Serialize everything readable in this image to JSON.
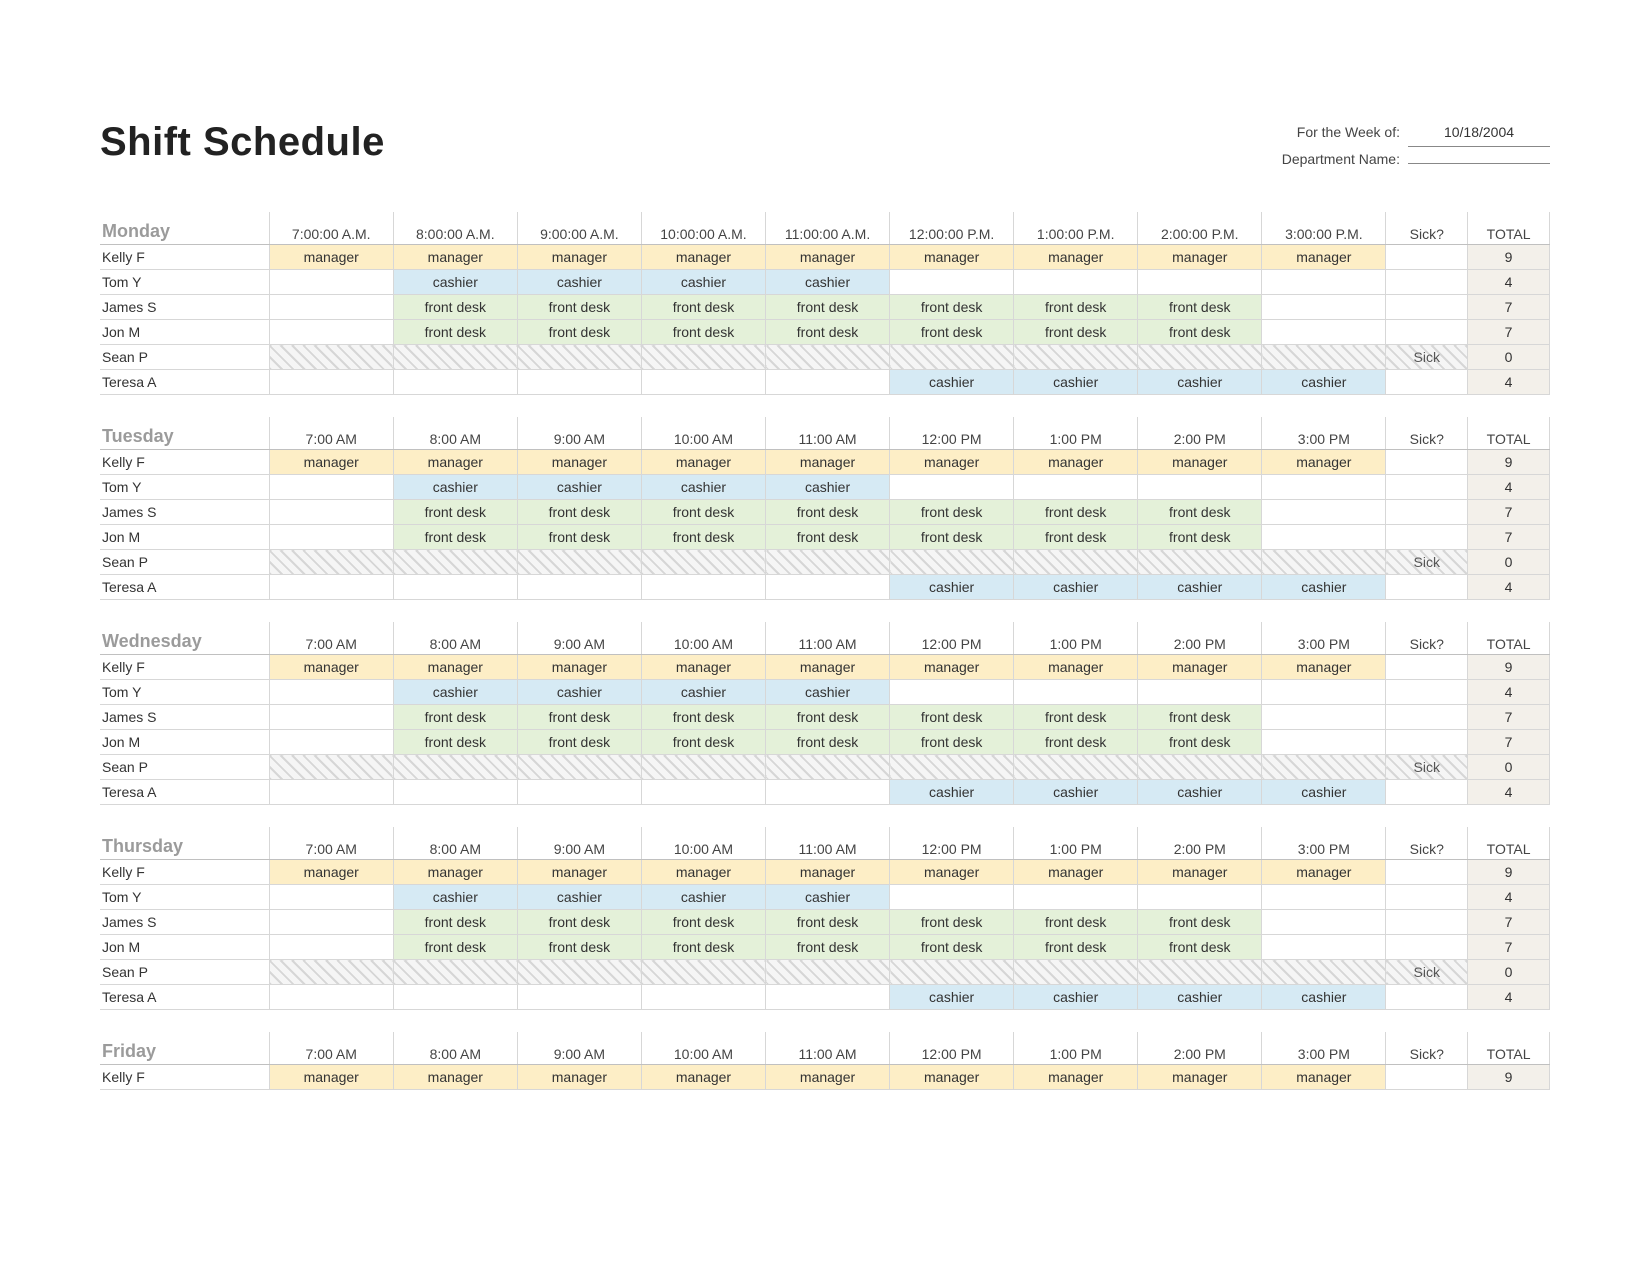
{
  "title": "Shift Schedule",
  "meta": {
    "week_of_label": "For the Week of:",
    "week_of_value": "10/18/2004",
    "department_label": "Department Name:",
    "department_value": ""
  },
  "columns": {
    "sick": "Sick?",
    "total": "TOTAL"
  },
  "roles": {
    "manager": {
      "label": "manager",
      "css": "role-manager"
    },
    "cashier": {
      "label": "cashier",
      "css": "role-cashier"
    },
    "front_desk": {
      "label": "front desk",
      "css": "role-front-desk"
    }
  },
  "days": [
    {
      "name": "Monday",
      "times": [
        "7:00:00 A.M.",
        "8:00:00 A.M.",
        "9:00:00 A.M.",
        "10:00:00 A.M.",
        "11:00:00 A.M.",
        "12:00:00 P.M.",
        "1:00:00 P.M.",
        "2:00:00 P.M.",
        "3:00:00 P.M."
      ],
      "rows": [
        {
          "employee": "Kelly F",
          "total": 9,
          "sick": "",
          "sick_row": false,
          "cells": [
            "manager",
            "manager",
            "manager",
            "manager",
            "manager",
            "manager",
            "manager",
            "manager",
            "manager"
          ]
        },
        {
          "employee": "Tom Y",
          "total": 4,
          "sick": "",
          "sick_row": false,
          "cells": [
            "",
            "cashier",
            "cashier",
            "cashier",
            "cashier",
            "",
            "",
            "",
            ""
          ]
        },
        {
          "employee": "James S",
          "total": 7,
          "sick": "",
          "sick_row": false,
          "cells": [
            "",
            "front_desk",
            "front_desk",
            "front_desk",
            "front_desk",
            "front_desk",
            "front_desk",
            "front_desk",
            ""
          ]
        },
        {
          "employee": "Jon M",
          "total": 7,
          "sick": "",
          "sick_row": false,
          "cells": [
            "",
            "front_desk",
            "front_desk",
            "front_desk",
            "front_desk",
            "front_desk",
            "front_desk",
            "front_desk",
            ""
          ]
        },
        {
          "employee": "Sean P",
          "total": 0,
          "sick": "Sick",
          "sick_row": true,
          "cells": [
            "",
            "",
            "",
            "",
            "",
            "",
            "",
            "",
            ""
          ]
        },
        {
          "employee": "Teresa A",
          "total": 4,
          "sick": "",
          "sick_row": false,
          "cells": [
            "",
            "",
            "",
            "",
            "",
            "cashier",
            "cashier",
            "cashier",
            "cashier"
          ]
        }
      ]
    },
    {
      "name": "Tuesday",
      "times": [
        "7:00 AM",
        "8:00 AM",
        "9:00 AM",
        "10:00 AM",
        "11:00 AM",
        "12:00 PM",
        "1:00 PM",
        "2:00 PM",
        "3:00 PM"
      ],
      "rows": [
        {
          "employee": "Kelly F",
          "total": 9,
          "sick": "",
          "sick_row": false,
          "cells": [
            "manager",
            "manager",
            "manager",
            "manager",
            "manager",
            "manager",
            "manager",
            "manager",
            "manager"
          ]
        },
        {
          "employee": "Tom Y",
          "total": 4,
          "sick": "",
          "sick_row": false,
          "cells": [
            "",
            "cashier",
            "cashier",
            "cashier",
            "cashier",
            "",
            "",
            "",
            ""
          ]
        },
        {
          "employee": "James S",
          "total": 7,
          "sick": "",
          "sick_row": false,
          "cells": [
            "",
            "front_desk",
            "front_desk",
            "front_desk",
            "front_desk",
            "front_desk",
            "front_desk",
            "front_desk",
            ""
          ]
        },
        {
          "employee": "Jon M",
          "total": 7,
          "sick": "",
          "sick_row": false,
          "cells": [
            "",
            "front_desk",
            "front_desk",
            "front_desk",
            "front_desk",
            "front_desk",
            "front_desk",
            "front_desk",
            ""
          ]
        },
        {
          "employee": "Sean P",
          "total": 0,
          "sick": "Sick",
          "sick_row": true,
          "cells": [
            "",
            "",
            "",
            "",
            "",
            "",
            "",
            "",
            ""
          ]
        },
        {
          "employee": "Teresa A",
          "total": 4,
          "sick": "",
          "sick_row": false,
          "cells": [
            "",
            "",
            "",
            "",
            "",
            "cashier",
            "cashier",
            "cashier",
            "cashier"
          ]
        }
      ]
    },
    {
      "name": "Wednesday",
      "times": [
        "7:00 AM",
        "8:00 AM",
        "9:00 AM",
        "10:00 AM",
        "11:00 AM",
        "12:00 PM",
        "1:00 PM",
        "2:00 PM",
        "3:00 PM"
      ],
      "rows": [
        {
          "employee": "Kelly F",
          "total": 9,
          "sick": "",
          "sick_row": false,
          "cells": [
            "manager",
            "manager",
            "manager",
            "manager",
            "manager",
            "manager",
            "manager",
            "manager",
            "manager"
          ]
        },
        {
          "employee": "Tom Y",
          "total": 4,
          "sick": "",
          "sick_row": false,
          "cells": [
            "",
            "cashier",
            "cashier",
            "cashier",
            "cashier",
            "",
            "",
            "",
            ""
          ]
        },
        {
          "employee": "James S",
          "total": 7,
          "sick": "",
          "sick_row": false,
          "cells": [
            "",
            "front_desk",
            "front_desk",
            "front_desk",
            "front_desk",
            "front_desk",
            "front_desk",
            "front_desk",
            ""
          ]
        },
        {
          "employee": "Jon M",
          "total": 7,
          "sick": "",
          "sick_row": false,
          "cells": [
            "",
            "front_desk",
            "front_desk",
            "front_desk",
            "front_desk",
            "front_desk",
            "front_desk",
            "front_desk",
            ""
          ]
        },
        {
          "employee": "Sean P",
          "total": 0,
          "sick": "Sick",
          "sick_row": true,
          "cells": [
            "",
            "",
            "",
            "",
            "",
            "",
            "",
            "",
            ""
          ]
        },
        {
          "employee": "Teresa A",
          "total": 4,
          "sick": "",
          "sick_row": false,
          "cells": [
            "",
            "",
            "",
            "",
            "",
            "cashier",
            "cashier",
            "cashier",
            "cashier"
          ]
        }
      ]
    },
    {
      "name": "Thursday",
      "times": [
        "7:00 AM",
        "8:00 AM",
        "9:00 AM",
        "10:00 AM",
        "11:00 AM",
        "12:00 PM",
        "1:00 PM",
        "2:00 PM",
        "3:00 PM"
      ],
      "rows": [
        {
          "employee": "Kelly F",
          "total": 9,
          "sick": "",
          "sick_row": false,
          "cells": [
            "manager",
            "manager",
            "manager",
            "manager",
            "manager",
            "manager",
            "manager",
            "manager",
            "manager"
          ]
        },
        {
          "employee": "Tom Y",
          "total": 4,
          "sick": "",
          "sick_row": false,
          "cells": [
            "",
            "cashier",
            "cashier",
            "cashier",
            "cashier",
            "",
            "",
            "",
            ""
          ]
        },
        {
          "employee": "James S",
          "total": 7,
          "sick": "",
          "sick_row": false,
          "cells": [
            "",
            "front_desk",
            "front_desk",
            "front_desk",
            "front_desk",
            "front_desk",
            "front_desk",
            "front_desk",
            ""
          ]
        },
        {
          "employee": "Jon M",
          "total": 7,
          "sick": "",
          "sick_row": false,
          "cells": [
            "",
            "front_desk",
            "front_desk",
            "front_desk",
            "front_desk",
            "front_desk",
            "front_desk",
            "front_desk",
            ""
          ]
        },
        {
          "employee": "Sean P",
          "total": 0,
          "sick": "Sick",
          "sick_row": true,
          "cells": [
            "",
            "",
            "",
            "",
            "",
            "",
            "",
            "",
            ""
          ]
        },
        {
          "employee": "Teresa A",
          "total": 4,
          "sick": "",
          "sick_row": false,
          "cells": [
            "",
            "",
            "",
            "",
            "",
            "cashier",
            "cashier",
            "cashier",
            "cashier"
          ]
        }
      ]
    },
    {
      "name": "Friday",
      "times": [
        "7:00 AM",
        "8:00 AM",
        "9:00 AM",
        "10:00 AM",
        "11:00 AM",
        "12:00 PM",
        "1:00 PM",
        "2:00 PM",
        "3:00 PM"
      ],
      "rows": [
        {
          "employee": "Kelly F",
          "total": 9,
          "sick": "",
          "sick_row": false,
          "cells": [
            "manager",
            "manager",
            "manager",
            "manager",
            "manager",
            "manager",
            "manager",
            "manager",
            "manager"
          ]
        }
      ]
    }
  ]
}
